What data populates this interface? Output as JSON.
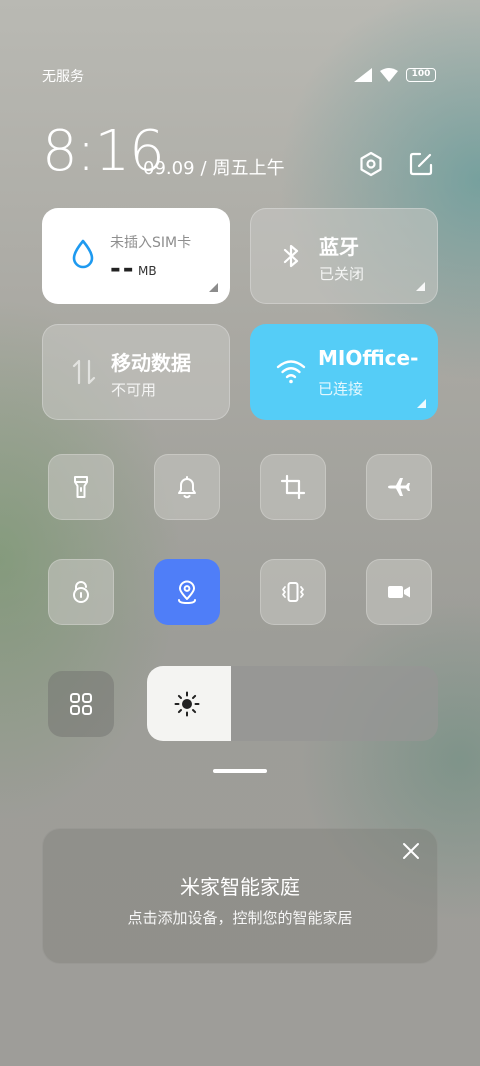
{
  "status_bar": {
    "carrier": "无服务",
    "battery": "100"
  },
  "header": {
    "time": "8:16",
    "date": "09.09",
    "weekday": "周五上午"
  },
  "tiles": {
    "data_usage": {
      "title": "未插入SIM卡",
      "value": "--",
      "unit": "MB"
    },
    "bluetooth": {
      "title": "蓝牙",
      "status": "已关闭"
    },
    "mobile_data": {
      "title": "移动数据",
      "status": "不可用"
    },
    "wifi": {
      "title": "MIOffice-",
      "status": "已连接"
    }
  },
  "toggles_row1": [
    {
      "name": "flashlight-icon",
      "active": false
    },
    {
      "name": "bell-icon",
      "active": false
    },
    {
      "name": "screenshot-crop-icon",
      "active": false
    },
    {
      "name": "airplane-icon",
      "active": false
    }
  ],
  "toggles_row2": [
    {
      "name": "rotation-lock-icon",
      "active": false
    },
    {
      "name": "location-icon",
      "active": true
    },
    {
      "name": "vibrate-icon",
      "active": false
    },
    {
      "name": "screen-record-icon",
      "active": false
    }
  ],
  "brightness": {
    "level": 0.29
  },
  "mijia": {
    "title": "米家智能家庭",
    "subtitle": "点击添加设备，控制您的智能家居"
  },
  "colors": {
    "accent_blue": "#4f7ef8",
    "wifi_tile": "#55cdf7",
    "data_drop": "#1e9af0"
  }
}
